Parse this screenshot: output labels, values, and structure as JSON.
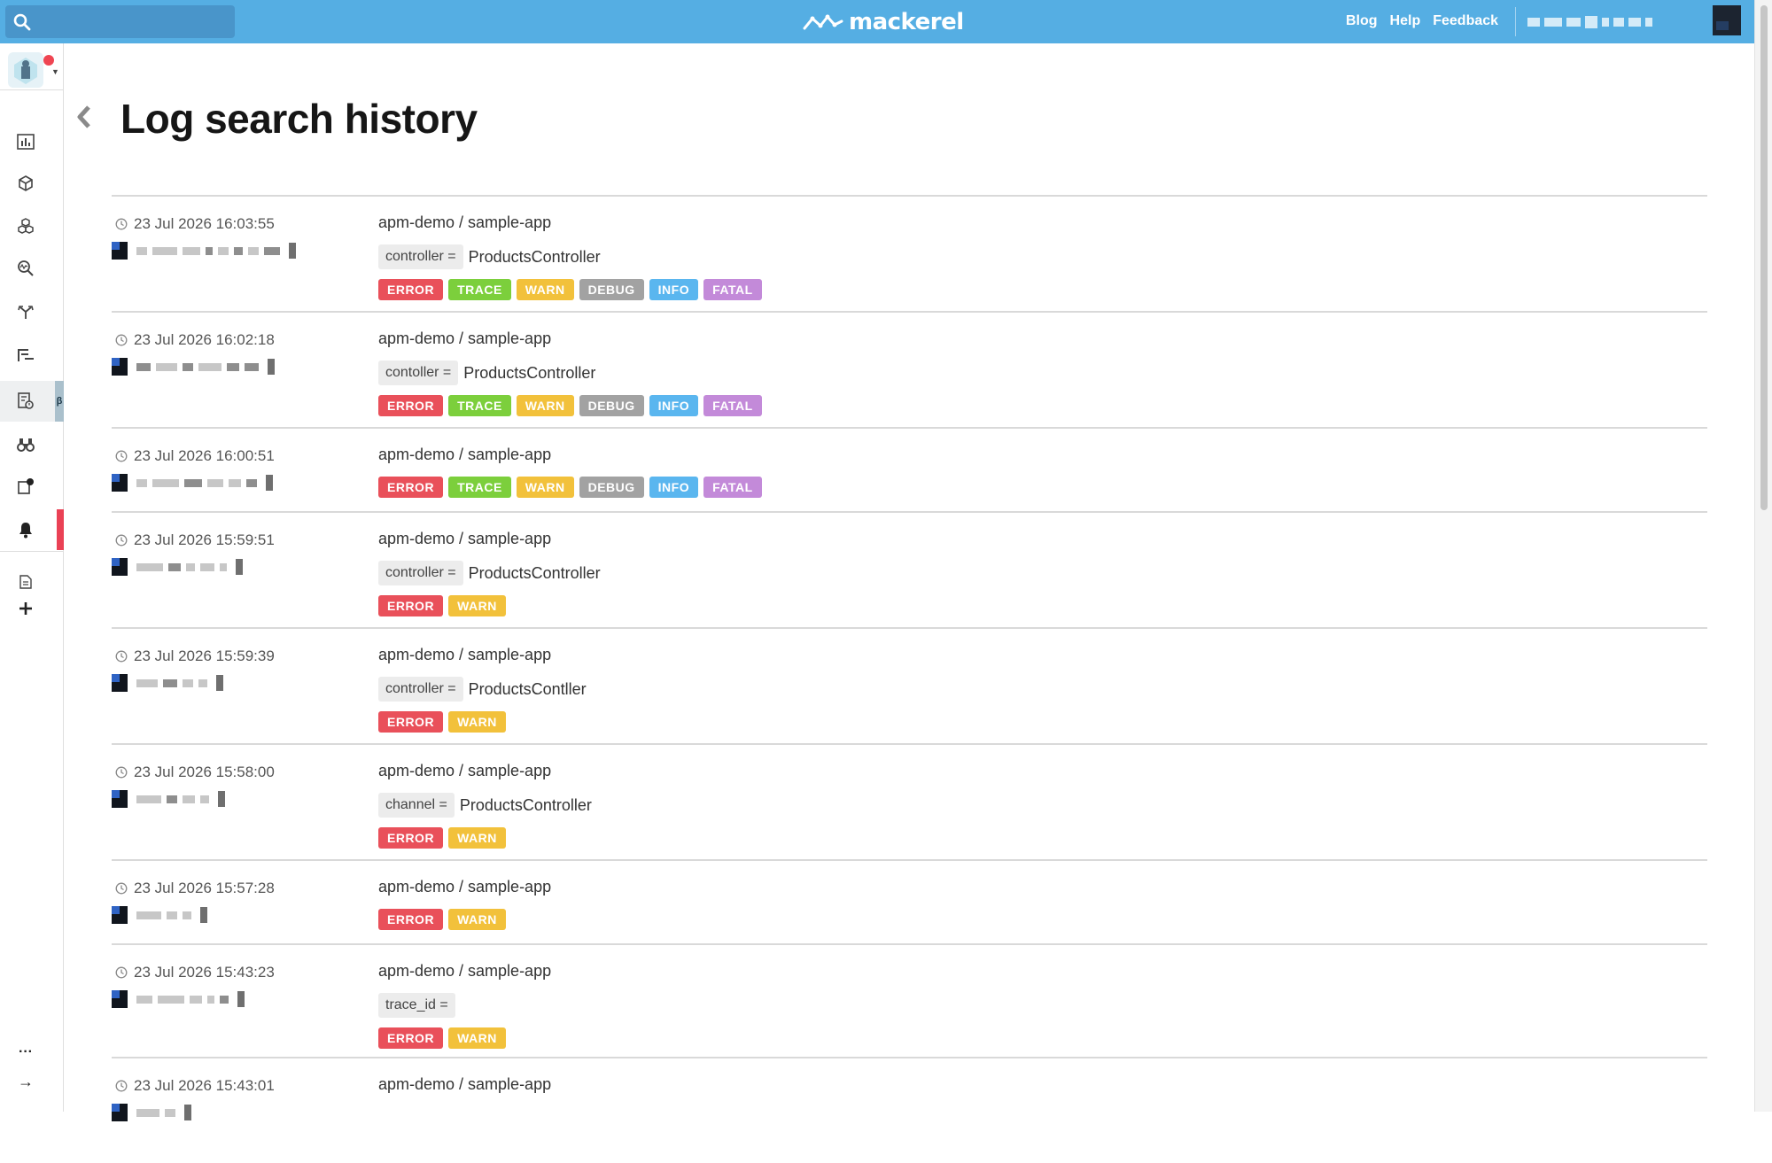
{
  "app": {
    "brand": "mackerel",
    "search_placeholder": "",
    "nav": [
      "Blog",
      "Help",
      "Feedback"
    ]
  },
  "colors": {
    "topbar": "#55aee3",
    "ERROR": "#e9505a",
    "TRACE": "#7ccf3c",
    "WARN": "#f2c13b",
    "DEBUG": "#a2a2a2",
    "INFO": "#5ab6ef",
    "FATAL": "#c38ad9"
  },
  "sidebar": {
    "items": [
      {
        "icon": "dashboard-icon",
        "active": false
      },
      {
        "icon": "box-icon",
        "active": false
      },
      {
        "icon": "hosts-stack-icon",
        "active": false
      },
      {
        "icon": "search-trace-icon",
        "active": false
      },
      {
        "icon": "fork-arrows-icon",
        "active": false
      },
      {
        "icon": "trace-list-icon",
        "active": false
      },
      {
        "icon": "log-search-icon",
        "active": true,
        "badge": "β"
      },
      {
        "icon": "binoculars-icon",
        "active": false
      },
      {
        "icon": "notification-box-icon",
        "active": false
      },
      {
        "icon": "bell-icon",
        "active": false
      },
      {
        "icon": "document-icon",
        "active": false
      },
      {
        "icon": "plus-icon",
        "active": false
      },
      {
        "icon": "more-icon",
        "label": "···"
      },
      {
        "icon": "expand-arrow-icon",
        "label": "→"
      }
    ]
  },
  "page": {
    "title": "Log search history"
  },
  "history": [
    {
      "time": "23 Jul 2026 16:03:55",
      "service": "apm-demo / sample-app",
      "filter_key": "controller =",
      "filter_value": "ProductsController",
      "levels": [
        "ERROR",
        "TRACE",
        "WARN",
        "DEBUG",
        "INFO",
        "FATAL"
      ]
    },
    {
      "time": "23 Jul 2026 16:02:18",
      "service": "apm-demo / sample-app",
      "filter_key": "contoller =",
      "filter_value": "ProductsController",
      "levels": [
        "ERROR",
        "TRACE",
        "WARN",
        "DEBUG",
        "INFO",
        "FATAL"
      ]
    },
    {
      "time": "23 Jul 2026 16:00:51",
      "service": "apm-demo / sample-app",
      "levels": [
        "ERROR",
        "TRACE",
        "WARN",
        "DEBUG",
        "INFO",
        "FATAL"
      ]
    },
    {
      "time": "23 Jul 2026 15:59:51",
      "service": "apm-demo / sample-app",
      "filter_key": "controller =",
      "filter_value": "ProductsController",
      "levels": [
        "ERROR",
        "WARN"
      ]
    },
    {
      "time": "23 Jul 2026 15:59:39",
      "service": "apm-demo / sample-app",
      "filter_key": "controller =",
      "filter_value": "ProductsContller",
      "levels": [
        "ERROR",
        "WARN"
      ]
    },
    {
      "time": "23 Jul 2026 15:58:00",
      "service": "apm-demo / sample-app",
      "filter_key": "channel =",
      "filter_value": "ProductsController",
      "levels": [
        "ERROR",
        "WARN"
      ]
    },
    {
      "time": "23 Jul 2026 15:57:28",
      "service": "apm-demo / sample-app",
      "levels": [
        "ERROR",
        "WARN"
      ]
    },
    {
      "time": "23 Jul 2026 15:43:23",
      "service": "apm-demo / sample-app",
      "filter_key": "trace_id =",
      "filter_value": "",
      "levels": [
        "ERROR",
        "WARN"
      ]
    },
    {
      "time": "23 Jul 2026 15:43:01",
      "service": "apm-demo / sample-app",
      "levels": []
    }
  ]
}
